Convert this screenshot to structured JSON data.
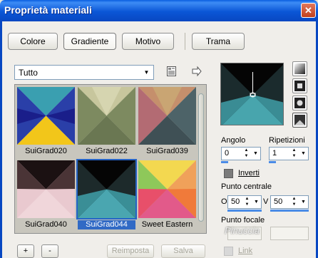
{
  "window": {
    "title": "Proprietà materiali",
    "close_symbol": "✕"
  },
  "tabs": [
    {
      "label": "Colore"
    },
    {
      "label": "Gradiente"
    },
    {
      "label": "Motivo"
    },
    {
      "label": "Trama"
    }
  ],
  "category": {
    "selected": "Tutto"
  },
  "gradients": [
    {
      "label": "SuiGrad020"
    },
    {
      "label": "SuiGrad022"
    },
    {
      "label": "SuiGrad039"
    },
    {
      "label": "SuiGrad040"
    },
    {
      "label": "SuiGrad044"
    },
    {
      "label": "Sweet Eastern"
    }
  ],
  "buttons": {
    "add": "+",
    "remove": "-",
    "reset": "Reimposta",
    "save": "Salva"
  },
  "settings": {
    "angle_label": "Angolo",
    "angle_value": "0",
    "repeats_label": "Ripetizioni",
    "repeats_value": "1",
    "invert_label": "Inverti",
    "center_label": "Punto centrale",
    "center_x_prefix": "O",
    "center_x": "50",
    "center_y_prefix": "V",
    "center_y": "50",
    "focal_label": "Punto focale",
    "link_label": "Link"
  },
  "watermark": "Pinuccia"
}
